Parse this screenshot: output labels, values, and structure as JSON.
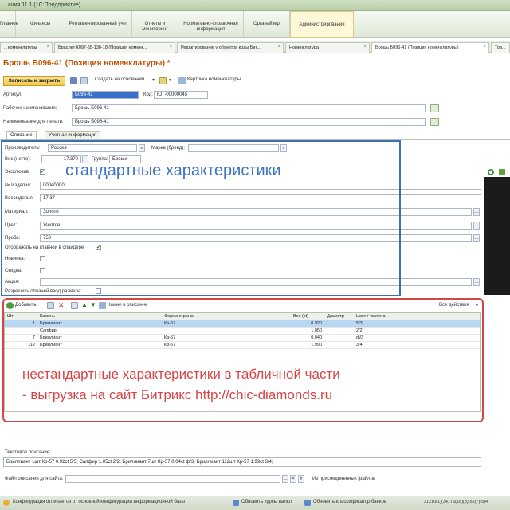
{
  "window": {
    "title": "...ация 11.1 (1С:Предприятие)"
  },
  "sections": [
    "Главное",
    "Финансы",
    "Регламентированный учет",
    "Отчеты и мониторинг",
    "Нормативно-справочная информация",
    "Органайзер",
    "Администрирование"
  ],
  "doc_tabs": [
    {
      "label": "...номенклатуры"
    },
    {
      "label": "Браслет К097-55-130-18 (Позиция номенк..."
    },
    {
      "label": "Редактирование у объектов коды Бит..."
    },
    {
      "label": "Номенклатура"
    },
    {
      "label": "Брошь Б096-41 (Позиция номенклатуры)"
    },
    {
      "label": "Тов..."
    }
  ],
  "form": {
    "title": "Брошь Б096-41 (Позиция номенклатуры) *",
    "toolbar": {
      "save_close": "Записать и закрыть",
      "create_based": "Создать на основании",
      "card": "Карточка номенклатуры"
    },
    "article_label": "Артикул:",
    "article_value": "Б096-41",
    "code_label": "Код:",
    "code_value": "ЮТ-00000045",
    "work_name_label": "Рабочее наименование:",
    "work_name_value": "Брошь Б096-41",
    "print_name_label": "Наименование для печати:",
    "print_name_value": "Брошь Б096-41"
  },
  "inner_tabs": [
    "Описание",
    "Учетная информация"
  ],
  "description": {
    "manufacturer_label": "Производитель:",
    "manufacturer_value": "Россия",
    "brand_label": "Марка (бренд):",
    "brand_value": "",
    "weight_label": "Вес (нетто):",
    "weight_value": "17.370",
    "group_label": "Группа:",
    "group_value": "Броши",
    "exclusive_label": "Эксклюзив:",
    "exclusive_check": "✔",
    "item_no_label": "№ Изделия:",
    "item_no_value": "00040000",
    "item_weight_label": "Вес изделия:",
    "item_weight_value": "17.37",
    "material_label": "Материал:",
    "material_value": "Золото",
    "color_label": "Цвет:",
    "color_value": "Желтое",
    "probe_label": "Проба:",
    "probe_value": "750",
    "show_slider_label": "Отображать на главной в слайдере",
    "show_slider_check": "✔",
    "new_label": "Новинка:",
    "sale_label": "Скидка:",
    "action_label": "Акция:",
    "allow_size_label": "Разрешить оплачей ввод размера:",
    "annotation": "стандартные характеристики"
  },
  "stones_toolbar": {
    "add": "Добавить",
    "stones_desc": "Камни в описание",
    "all_actions": "Все действия"
  },
  "stones_table": {
    "columns": [
      "Шт",
      "Камень",
      "Форма огранки",
      "Вес (ct)",
      "Диаметр",
      "Цвет / частота"
    ],
    "rows": [
      [
        "1",
        "Бриллиант",
        "Кр-57",
        "0.920",
        "",
        "5/3"
      ],
      [
        "",
        "Сапфир",
        "",
        "1.050",
        "",
        "2/2"
      ],
      [
        "7",
        "Бриллиант",
        "Кр-57",
        "0.040",
        "",
        "ф/3"
      ],
      [
        "112",
        "Бриллиант",
        "Кр-57",
        "1.990",
        "",
        "3/4"
      ]
    ]
  },
  "annotation_red": {
    "line1": "нестандартные характеристики в табличной части",
    "line2": "- выгрузка на сайт Битрикс http://chic-diamonds.ru"
  },
  "text_desc": {
    "label": "Текстовое описание:",
    "value": "Бриллиант 1шт Кр-57 0.92ct 5/3; Сапфир 1.05ct 2/2; Бриллиант 7шт Кр-57 0.04ct ф/3; Бриллиант 112шт Кр-57 1.99ct 3/4;"
  },
  "file_desc": {
    "label": "Файл описания для сайта:",
    "from_files": "Из присоединенных файлов"
  },
  "statusbar": {
    "config_msg": "Конфигурация отличается от основной конфигурации информационной базы",
    "update_rates": "Обновить курсы валют",
    "update_banks": "Обновить классификатор банков",
    "counter": "31210(1)(34176(18)(3)(51(7)(5)4"
  },
  "colors": {
    "accent": "#c24f00",
    "blue_annotation": "#3b73c6",
    "red_annotation": "#d64545"
  }
}
